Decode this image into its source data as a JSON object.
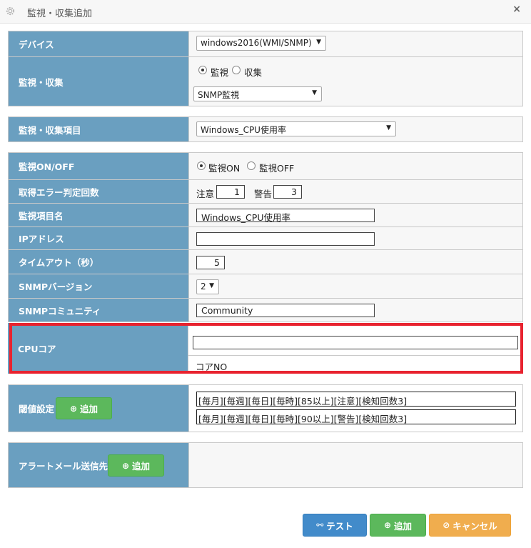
{
  "window": {
    "title": "監視・収集追加",
    "close": "×"
  },
  "device": {
    "label": "デバイス",
    "value": "windows2016(WMI/SNMP)"
  },
  "kanshi": {
    "label": "監視・収集",
    "radio1": "監視",
    "radio2": "収集",
    "selected": "監視",
    "select_value": "SNMP監視"
  },
  "item": {
    "label": "監視・収集項目",
    "value": "Windows_CPU使用率"
  },
  "onoff": {
    "label": "監視ON/OFF",
    "on": "監視ON",
    "off": "監視OFF",
    "selected": "監視ON"
  },
  "error": {
    "label": "取得エラー判定回数",
    "caution_label": "注意",
    "caution_value": "1",
    "warning_label": "警告",
    "warning_value": "3"
  },
  "itemname": {
    "label": "監視項目名",
    "value": "Windows_CPU使用率"
  },
  "ip": {
    "label": "IPアドレス",
    "value": ""
  },
  "timeout": {
    "label": "タイムアウト（秒）",
    "value": "5"
  },
  "snmpver": {
    "label": "SNMPバージョン",
    "value": "2"
  },
  "community": {
    "label": "SNMPコミュニティ",
    "value": "Community"
  },
  "cpu": {
    "label": "CPUコア",
    "value": "",
    "note": "コアNO"
  },
  "threshold": {
    "label": "閾値設定",
    "add": "追加",
    "entries": [
      "[毎月][毎週][毎日][毎時][85以上][注意][検知回数3]",
      "[毎月][毎週][毎日][毎時][90以上][警告][検知回数3]"
    ]
  },
  "alert": {
    "label": "アラートメール送信先",
    "add": "追加"
  },
  "footer": {
    "test": "テスト",
    "add": "追加",
    "cancel": "キャンセル"
  },
  "colors": {
    "label_bg": "#6a9fc0",
    "highlight": "#e8232f",
    "green": "#5cb85c",
    "blue": "#428bca",
    "orange": "#f0ad4e"
  }
}
